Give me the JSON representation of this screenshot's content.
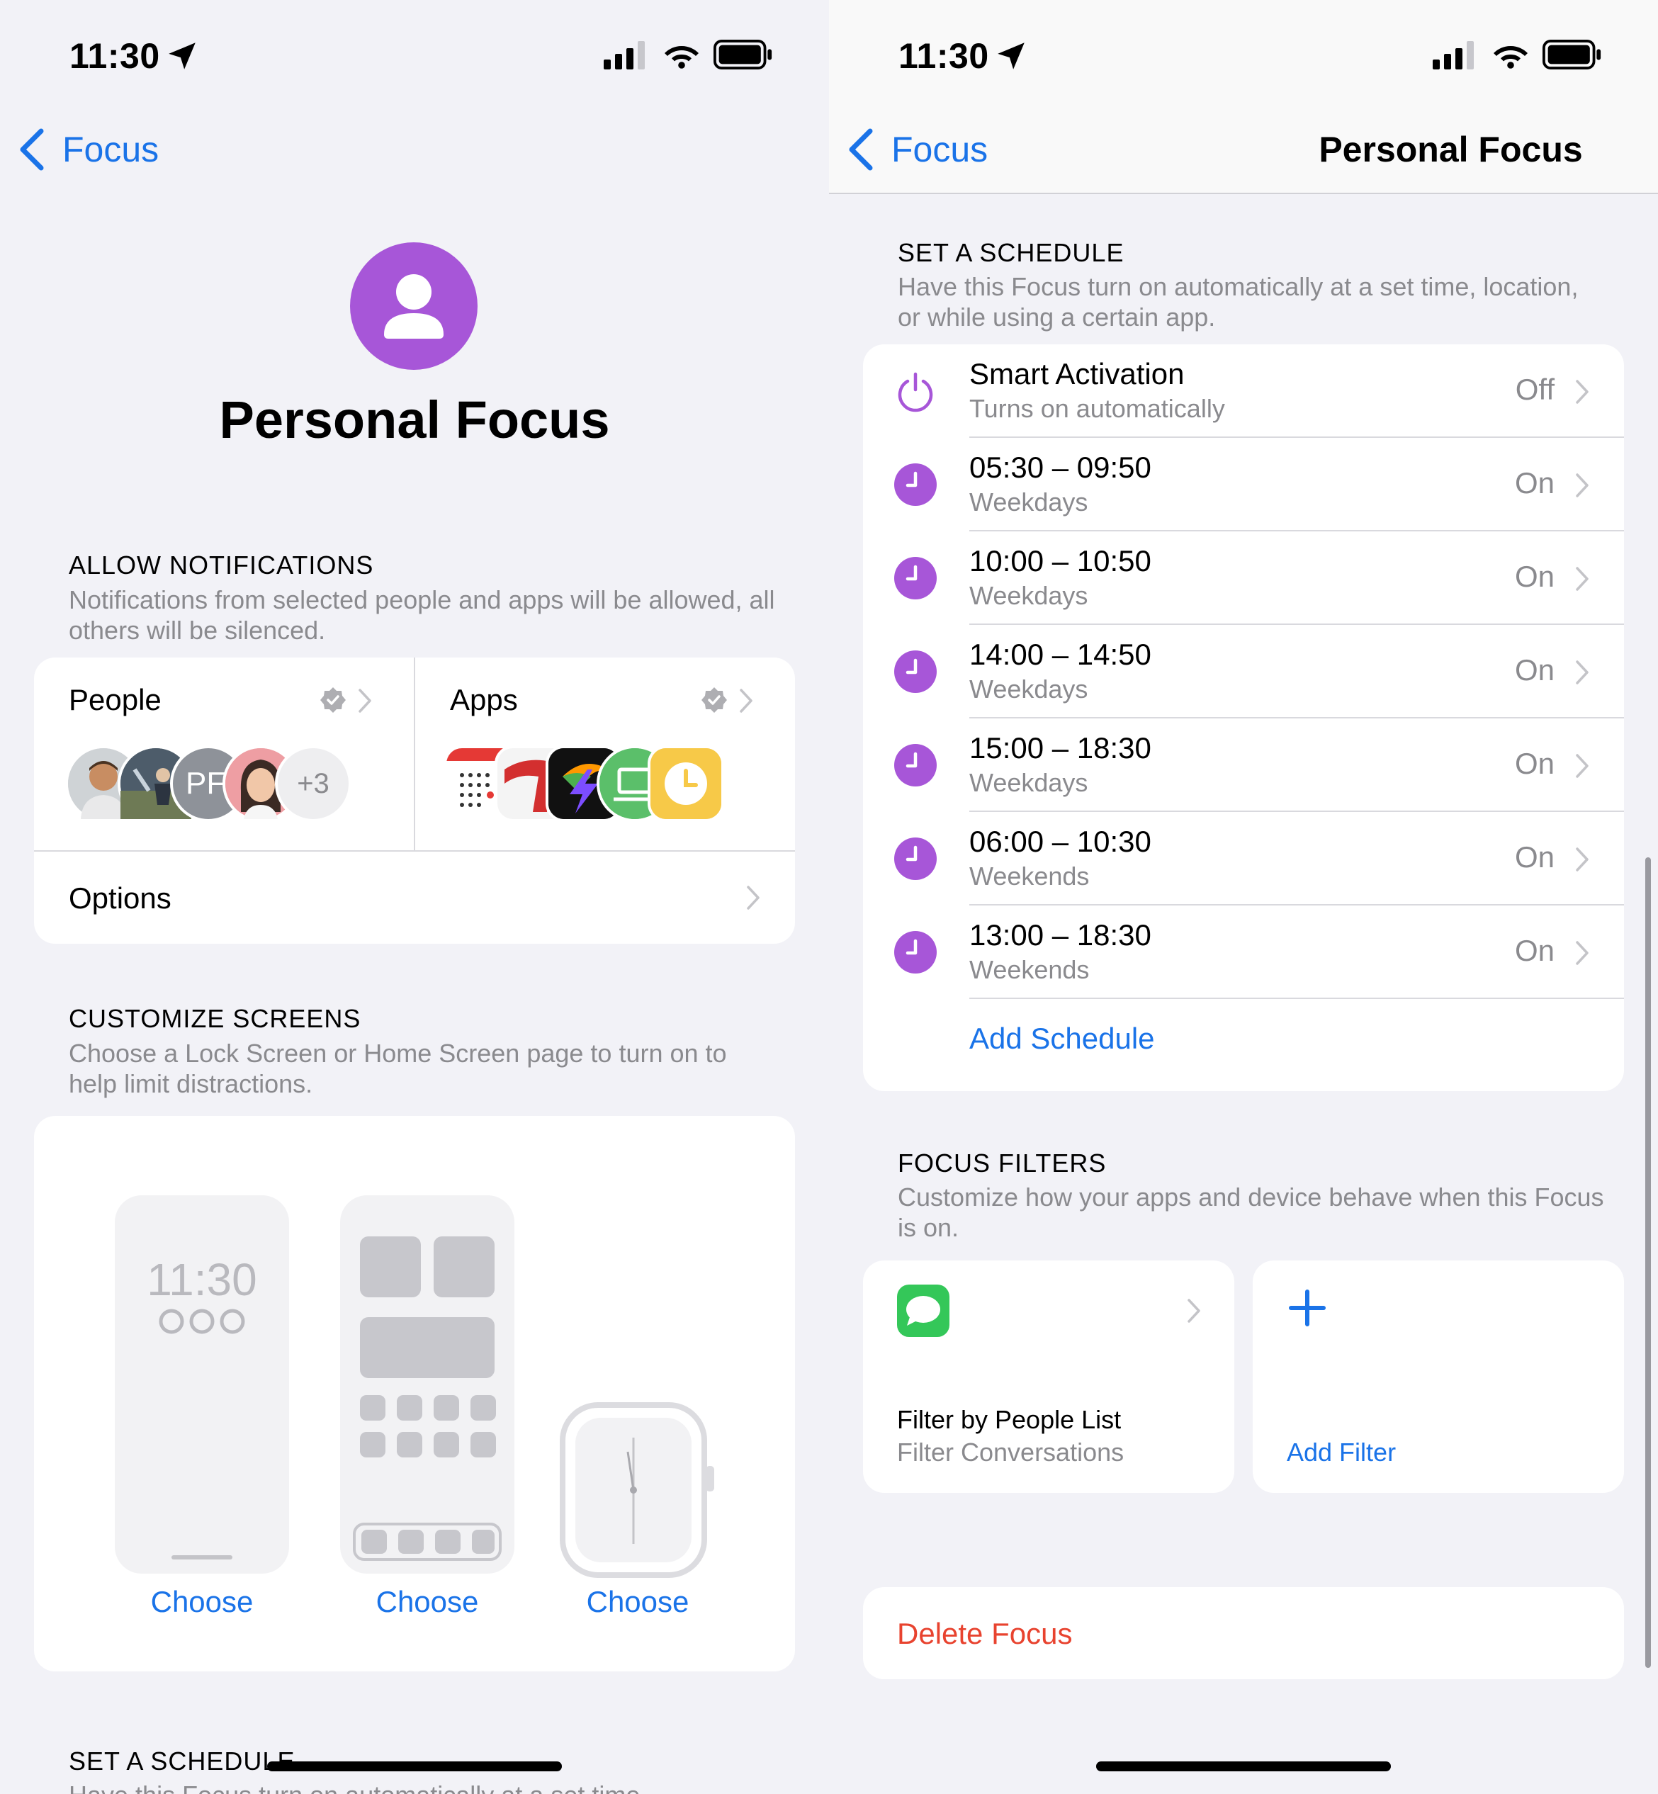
{
  "left": {
    "status": {
      "time": "11:30"
    },
    "nav": {
      "back_label": "Focus"
    },
    "hero": {
      "title": "Personal Focus"
    },
    "allow_notifications": {
      "header": "ALLOW NOTIFICATIONS",
      "description": "Notifications from selected people and apps will be allowed, all others will be silenced.",
      "people_label": "People",
      "people_initials": "PF",
      "people_more": "+3",
      "apps_label": "Apps",
      "options_label": "Options"
    },
    "customize_screens": {
      "header": "CUSTOMIZE SCREENS",
      "description": "Choose a Lock Screen or Home Screen page to turn on to help limit distractions.",
      "lock_preview_time": "11:30",
      "choose_lock": "Choose",
      "choose_home": "Choose",
      "choose_watch": "Choose"
    },
    "next_section": {
      "header": "SET A SCHEDULE",
      "description": "Have this Focus turn on automatically at a set time,"
    }
  },
  "right": {
    "status": {
      "time": "11:30"
    },
    "nav": {
      "back_label": "Focus",
      "title": "Personal Focus"
    },
    "schedule": {
      "header": "SET A SCHEDULE",
      "description": "Have this Focus turn on automatically at a set time, location, or while using a certain app.",
      "smart": {
        "title": "Smart Activation",
        "subtitle": "Turns on automatically",
        "state": "Off"
      },
      "items": [
        {
          "time": "05:30 – 09:50",
          "days": "Weekdays",
          "state": "On"
        },
        {
          "time": "10:00 – 10:50",
          "days": "Weekdays",
          "state": "On"
        },
        {
          "time": "14:00 – 14:50",
          "days": "Weekdays",
          "state": "On"
        },
        {
          "time": "15:00 – 18:30",
          "days": "Weekdays",
          "state": "On"
        },
        {
          "time": "06:00 – 10:30",
          "days": "Weekends",
          "state": "On"
        },
        {
          "time": "13:00 – 18:30",
          "days": "Weekends",
          "state": "On"
        }
      ],
      "add_label": "Add Schedule"
    },
    "filters": {
      "header": "FOCUS FILTERS",
      "description": "Customize how your apps and device behave when this Focus is on.",
      "filter_title": "Filter by People List",
      "filter_subtitle": "Filter Conversations",
      "add_label": "Add Filter"
    },
    "delete_label": "Delete Focus"
  },
  "colors": {
    "accent": "#1a73e8",
    "focus_purple": "#a756d8",
    "destructive": "#e8432f",
    "background": "#f2f2f7",
    "secondary_text": "#8a8a8e"
  }
}
